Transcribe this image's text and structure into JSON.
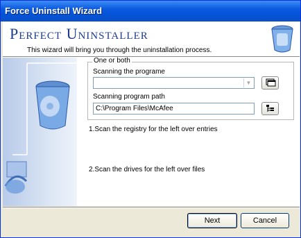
{
  "window": {
    "title": "Force Uninstall Wizard"
  },
  "header": {
    "app_title": "Perfect Uninstaller",
    "subtitle": "This wizard will bring you through the uninstallation process.",
    "icon": "trash-can-icon"
  },
  "group": {
    "label": "One or both",
    "program_label": "Scanning the programe",
    "program_value": "",
    "path_label": "Scanning program path",
    "path_value": "C:\\Program Files\\McAfee"
  },
  "steps": {
    "step1": "1.Scan the registry for the left over entries",
    "step2": "2.Scan the drives for the left over files"
  },
  "buttons": {
    "next": "Next",
    "cancel": "Cancel"
  },
  "colors": {
    "titlebar": "#0453d6",
    "accent": "#1d3c8f"
  }
}
